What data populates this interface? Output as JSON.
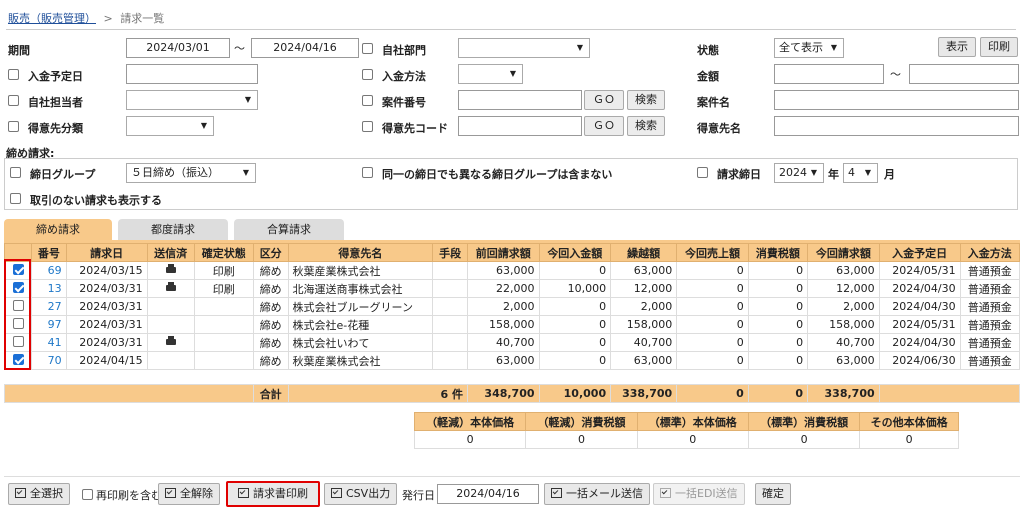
{
  "breadcrumb": {
    "parent": "販売（販売管理）",
    "sep": ">",
    "current": "請求一覧"
  },
  "form": {
    "period_label": "期間",
    "date_from": "2024/03/01",
    "tilde": "〜",
    "date_to": "2024/04/16",
    "dept_label": "自社部門",
    "status_label": "状態",
    "status_value": "全て表示",
    "show_btn": "表示",
    "print_btn": "印刷",
    "due_label": "入金予定日",
    "method_label": "入金方法",
    "amount_label": "金額",
    "staff_label": "自社担当者",
    "case_no_label": "案件番号",
    "go": "ＧＯ",
    "search": "検索",
    "case_name_label": "案件名",
    "cust_class_label": "得意先分類",
    "cust_code_label": "得意先コード",
    "cust_name_label": "得意先名",
    "closing_title": "締め請求:",
    "closing_group_label": "締日グループ",
    "closing_group_value": "５日締め（振込）",
    "same_day_label": "同一の締日でも異なる締日グループは含まない",
    "bill_day_label": "請求締日",
    "year_value": "2024",
    "year_unit": "年",
    "month_value": "4",
    "month_unit": "月",
    "no_txn_label": "取引のない請求も表示する"
  },
  "tabs": [
    "締め請求",
    "都度請求",
    "合算請求"
  ],
  "table": {
    "headers": [
      "",
      "番号",
      "請求日",
      "送信済",
      "確定状態",
      "区分",
      "得意先名",
      "手段",
      "前回請求額",
      "今回入金額",
      "繰越額",
      "今回売上額",
      "消費税額",
      "今回請求額",
      "入金予定日",
      "入金方法"
    ],
    "rows": [
      {
        "checked": true,
        "no": "69",
        "date": "2024/03/15",
        "sent": true,
        "state": "印刷",
        "kubun": "締め",
        "customer": "秋葉産業株式会社",
        "means": "",
        "prev": "63,000",
        "paid": "0",
        "carry": "63,000",
        "sales": "0",
        "tax": "0",
        "bill": "63,000",
        "due": "2024/05/31",
        "method": "普通預金"
      },
      {
        "checked": true,
        "no": "13",
        "date": "2024/03/31",
        "sent": true,
        "state": "印刷",
        "kubun": "締め",
        "customer": "北海運送商事株式会社",
        "means": "",
        "prev": "22,000",
        "paid": "10,000",
        "carry": "12,000",
        "sales": "0",
        "tax": "0",
        "bill": "12,000",
        "due": "2024/04/30",
        "method": "普通預金"
      },
      {
        "checked": false,
        "no": "27",
        "date": "2024/03/31",
        "sent": false,
        "state": "",
        "kubun": "締め",
        "customer": "株式会社ブルーグリーン",
        "means": "",
        "prev": "2,000",
        "paid": "0",
        "carry": "2,000",
        "sales": "0",
        "tax": "0",
        "bill": "2,000",
        "due": "2024/04/30",
        "method": "普通預金"
      },
      {
        "checked": false,
        "no": "97",
        "date": "2024/03/31",
        "sent": false,
        "state": "",
        "kubun": "締め",
        "customer": "株式会社e-花種",
        "means": "",
        "prev": "158,000",
        "paid": "0",
        "carry": "158,000",
        "sales": "0",
        "tax": "0",
        "bill": "158,000",
        "due": "2024/05/31",
        "method": "普通預金"
      },
      {
        "checked": false,
        "no": "41",
        "date": "2024/03/31",
        "sent": true,
        "state": "",
        "kubun": "締め",
        "customer": "株式会社いわて",
        "means": "",
        "prev": "40,700",
        "paid": "0",
        "carry": "40,700",
        "sales": "0",
        "tax": "0",
        "bill": "40,700",
        "due": "2024/04/30",
        "method": "普通預金"
      },
      {
        "checked": true,
        "no": "70",
        "date": "2024/04/15",
        "sent": false,
        "state": "",
        "kubun": "締め",
        "customer": "秋葉産業株式会社",
        "means": "",
        "prev": "63,000",
        "paid": "0",
        "carry": "63,000",
        "sales": "0",
        "tax": "0",
        "bill": "63,000",
        "due": "2024/06/30",
        "method": "普通預金"
      }
    ],
    "total": {
      "label": "合計",
      "count": "6 件",
      "prev": "348,700",
      "paid": "10,000",
      "carry": "338,700",
      "sales": "0",
      "tax": "0",
      "bill": "338,700"
    }
  },
  "summary": {
    "headers": [
      "（軽減）本体価格",
      "（軽減）消費税額",
      "（標準）本体価格",
      "（標準）消費税額",
      "その他本体価格"
    ],
    "values": [
      "0",
      "0",
      "0",
      "0",
      "0"
    ]
  },
  "footer": {
    "select_all": "全選択",
    "reprint": "再印刷を含む",
    "deselect_all": "全解除",
    "invoice_print": "請求書印刷",
    "csv": "CSV出力",
    "issue_date_label": "発行日",
    "issue_date": "2024/04/16",
    "mail": "一括メール送信",
    "edi": "一括EDI送信",
    "confirm": "確定"
  },
  "colors": {
    "header_orange": "#f8c98a",
    "tab_active": "#f8c98a",
    "highlight_red": "#e00000",
    "link_blue": "#1f78c8"
  }
}
